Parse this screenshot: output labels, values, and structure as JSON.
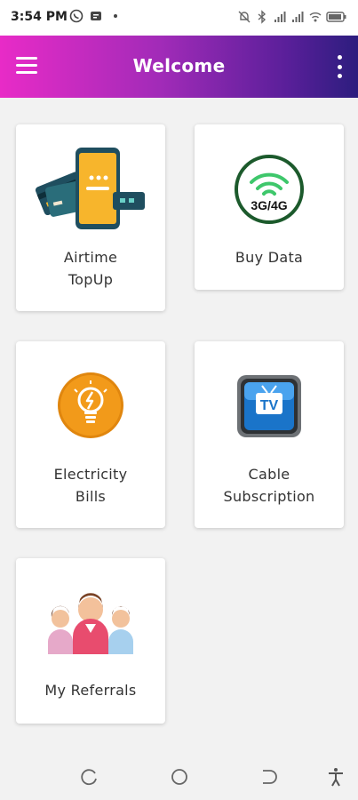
{
  "status_bar": {
    "time": "3:54 PM",
    "left_icons": [
      "whatsapp-icon",
      "message-icon",
      "dot-icon"
    ],
    "right_icons": [
      "mute-icon",
      "bluetooth-icon",
      "signal-icon",
      "signal-icon",
      "wifi-icon",
      "battery-icon"
    ]
  },
  "app_bar": {
    "title": "Welcome",
    "left_icon": "menu-icon",
    "right_icon": "more-vert-icon"
  },
  "tiles": [
    {
      "label": "Airtime\nTopUp",
      "icon": "airtime-phone-card-icon"
    },
    {
      "label": "Buy Data",
      "icon": "data-3g4g-icon"
    },
    {
      "label": "Electricity\nBills",
      "icon": "lightbulb-icon"
    },
    {
      "label": "Cable\nSubscription",
      "icon": "tv-icon"
    },
    {
      "label": "My Referrals",
      "icon": "referrals-people-icon"
    }
  ],
  "data_icon_text": "3G/4G",
  "tv_icon_text": "TV",
  "nav_bar": {
    "buttons": [
      "recent-apps-icon",
      "home-icon",
      "back-icon",
      "accessibility-icon"
    ]
  },
  "colors": {
    "appbar_gradient_start": "#e82bc7",
    "appbar_gradient_end": "#2c1d7e",
    "background": "#f2f2f2",
    "tile_background": "#ffffff"
  }
}
